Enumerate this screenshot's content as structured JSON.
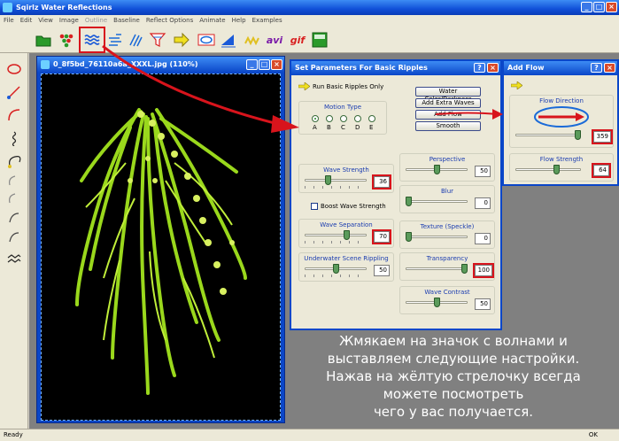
{
  "app": {
    "title": "Sqirlz Water Reflections"
  },
  "menu": [
    "File",
    "Edit",
    "View",
    "Image",
    "Outline",
    "Baseline",
    "Reflect Options",
    "Animate",
    "Help",
    "Examples"
  ],
  "toolbar": {
    "avi_label": "avi",
    "gif_label": "gif"
  },
  "image_window": {
    "title": "0_8f5bd_76110a6a_XXXL.jpg (110%)"
  },
  "ripples_dialog": {
    "title": "Set Parameters For Basic Ripples",
    "run_label": "Run Basic Ripples Only",
    "motion_type": {
      "label": "Motion Type",
      "options": [
        "A",
        "B",
        "C",
        "D",
        "E"
      ],
      "selected": "A"
    },
    "buttons": [
      "Water Color/Darkness",
      "Add Extra Waves",
      "Add Flow",
      "Smooth"
    ],
    "wave_strength": {
      "label": "Wave Strength",
      "value": "36"
    },
    "boost_label": "Boost Wave Strength",
    "wave_separation": {
      "label": "Wave Separation",
      "value": "70"
    },
    "underwater": {
      "label": "Underwater Scene Rippling",
      "value": "50"
    },
    "perspective": {
      "label": "Perspective",
      "value": "50"
    },
    "blur": {
      "label": "Blur",
      "value": "0"
    },
    "texture": {
      "label": "Texture (Speckle)",
      "value": "0"
    },
    "transparency": {
      "label": "Transparency",
      "value": "100"
    },
    "wave_contrast": {
      "label": "Wave Contrast",
      "value": "50"
    }
  },
  "flow_dialog": {
    "title": "Add Flow",
    "flow_direction": {
      "label": "Flow Direction",
      "value": "359"
    },
    "flow_strength": {
      "label": "Flow Strength",
      "value": "64"
    }
  },
  "status": {
    "left": "Ready",
    "right": "OK"
  },
  "annotation": {
    "lines": [
      "Жмякаем на значок с волнами и",
      "выставляем следующие настройки.",
      "Нажав на жёлтую стрелочку всегда",
      "можете посмотреть",
      "чего у вас получается."
    ]
  },
  "colors": {
    "highlight": "#d8141c",
    "title_blue": "#0a46c8",
    "plant": "#9ad81c"
  }
}
